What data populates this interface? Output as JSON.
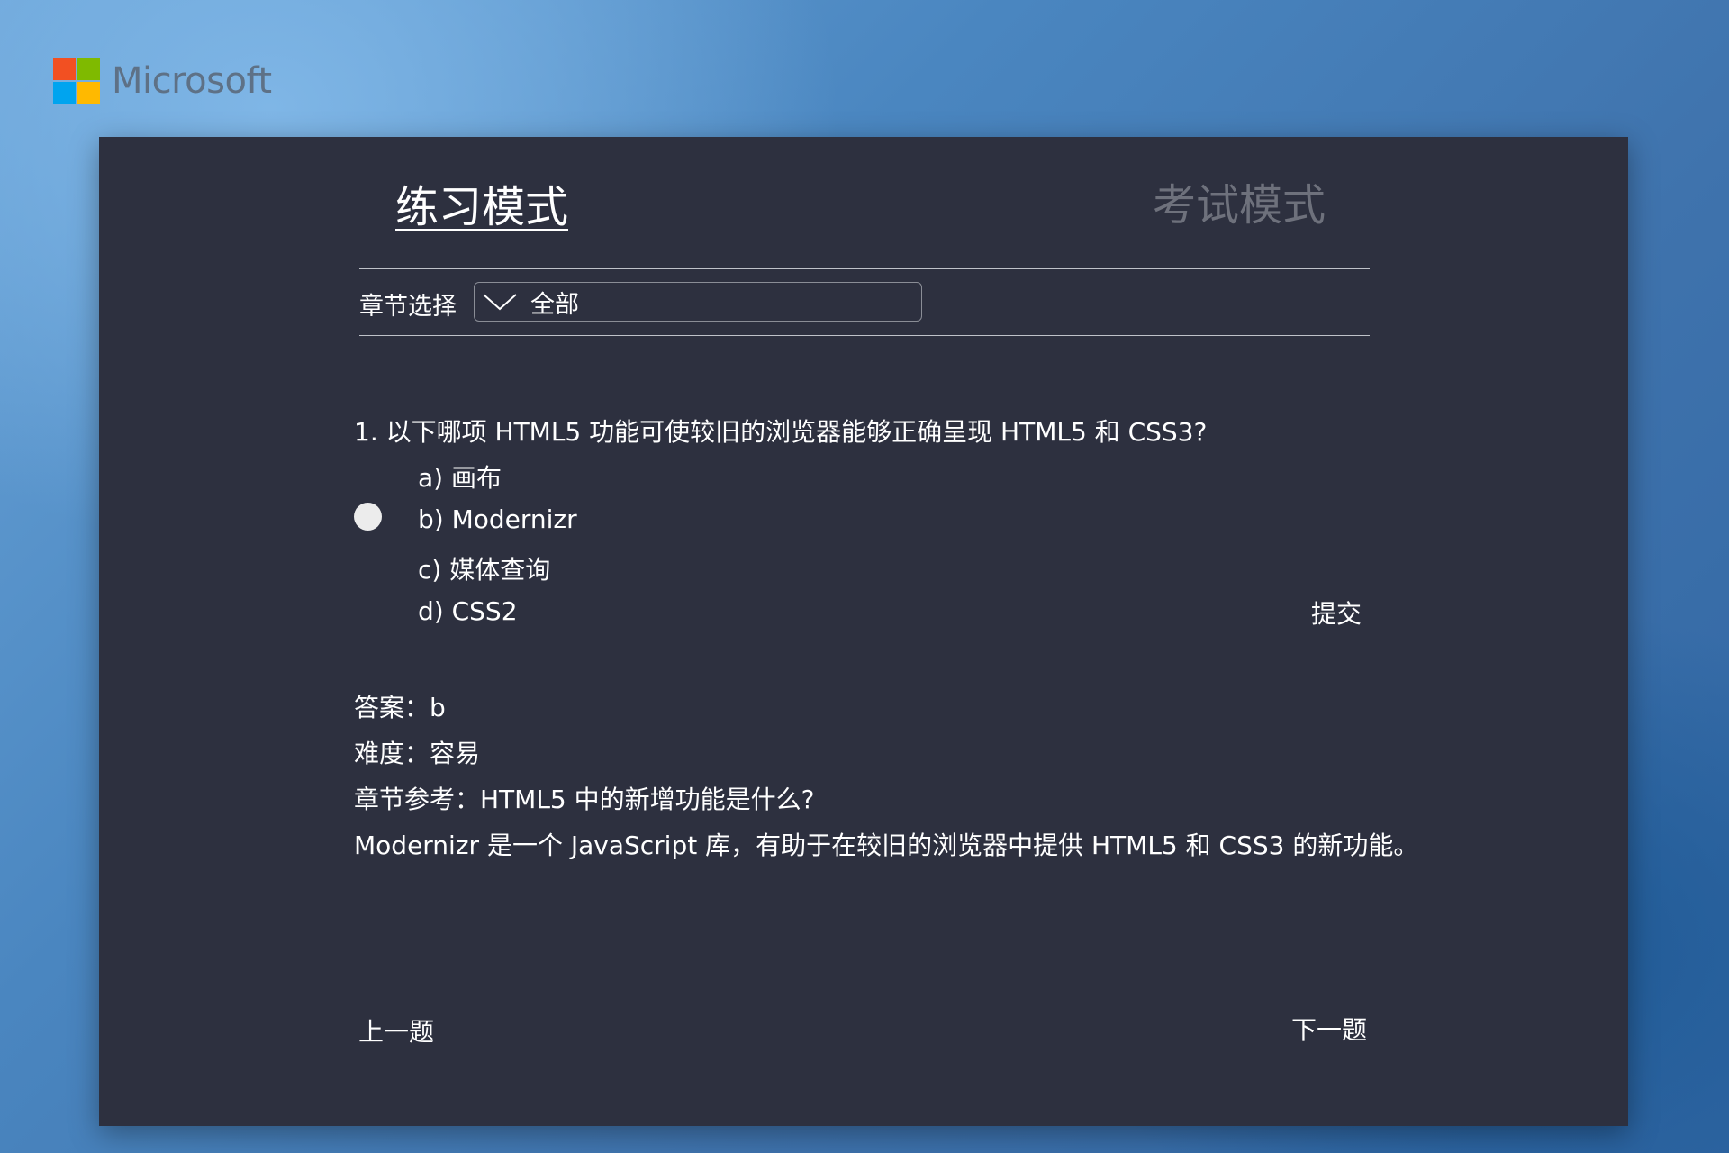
{
  "brand": {
    "name": "Microsoft",
    "colors": [
      "#f25022",
      "#7fba00",
      "#00a4ef",
      "#ffb900"
    ]
  },
  "tabs": {
    "practice": "练习模式",
    "exam": "考试模式"
  },
  "chapter": {
    "label": "章节选择",
    "selected": "全部",
    "icon": "chevron-down-icon"
  },
  "question": {
    "text": "1. 以下哪项 HTML5 功能可使较旧的浏览器能够正确呈现 HTML5 和 CSS3?",
    "options": [
      {
        "label": "a) 画布"
      },
      {
        "label": "b) Modernizr"
      },
      {
        "label": "c) 媒体查询"
      },
      {
        "label": "d) CSS2"
      }
    ],
    "selected": "b"
  },
  "submit_label": "提交",
  "result": {
    "answer": "答案：b",
    "difficulty": "难度：容易",
    "reference": "章节参考：HTML5 中的新增功能是什么?",
    "explanation": "Modernizr 是一个 JavaScript 库，有助于在较旧的浏览器中提供 HTML5 和 CSS3 的新功能。"
  },
  "nav": {
    "prev": "上一题",
    "next": "下一题"
  },
  "theme": {
    "panel_bg": "#2d303f",
    "text": "#ffffff",
    "inactive_tab": "#6e717c"
  }
}
